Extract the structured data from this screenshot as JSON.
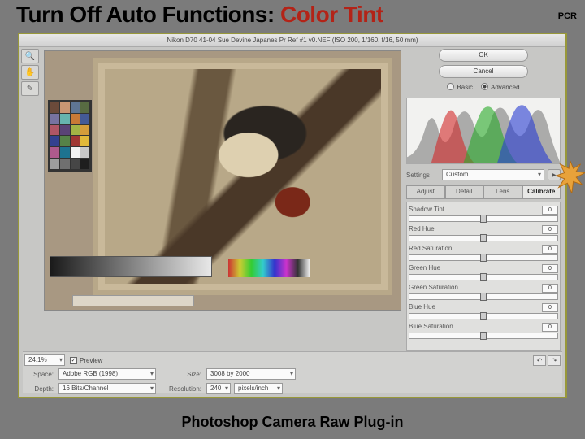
{
  "slide": {
    "title_plain": "Turn Off Auto Functions: ",
    "title_accent": "Color Tint",
    "corner": "PCR",
    "footer": "Photoshop Camera Raw Plug-in"
  },
  "titlebar": "Nikon D70  41-04 Sue Devine Japanes Pr Ref #1 v0.NEF  (ISO 200, 1/160, f/16, 50 mm)",
  "buttons": {
    "ok": "OK",
    "cancel": "Cancel"
  },
  "mode": {
    "basic": "Basic",
    "advanced": "Advanced"
  },
  "settings": {
    "label": "Settings",
    "value": "Custom"
  },
  "tabs": {
    "adjust": "Adjust",
    "detail": "Detail",
    "lens": "Lens",
    "calibrate": "Calibrate"
  },
  "sliders": [
    {
      "label": "Shadow Tint",
      "value": "0"
    },
    {
      "label": "Red Hue",
      "value": "0"
    },
    {
      "label": "Red Saturation",
      "value": "0"
    },
    {
      "label": "Green Hue",
      "value": "0"
    },
    {
      "label": "Green Saturation",
      "value": "0"
    },
    {
      "label": "Blue Hue",
      "value": "0"
    },
    {
      "label": "Blue Saturation",
      "value": "0"
    }
  ],
  "zoom": "24.1%",
  "preview_label": "Preview",
  "nav": {
    "r90": "R 90°",
    "l90": "L 90°"
  },
  "bottom": {
    "space_label": "Space:",
    "space_value": "Adobe RGB (1998)",
    "size_label": "Size:",
    "size_value": "3008 by 2000",
    "depth_label": "Depth:",
    "depth_value": "16 Bits/Channel",
    "res_label": "Resolution:",
    "res_value": "240",
    "res_unit": "pixels/inch"
  },
  "colorchart": [
    "#6b4a3a",
    "#c99673",
    "#5f7694",
    "#586b42",
    "#7773a0",
    "#67b4ae",
    "#c97a36",
    "#445a96",
    "#b05665",
    "#5a4376",
    "#a3b445",
    "#d69d3a",
    "#34418f",
    "#568248",
    "#a03733",
    "#e2b93a",
    "#ae5a8c",
    "#1e7390",
    "#f2f2f2",
    "#c8c8c8",
    "#9e9e9e",
    "#707070",
    "#464646",
    "#1e1e1e"
  ]
}
